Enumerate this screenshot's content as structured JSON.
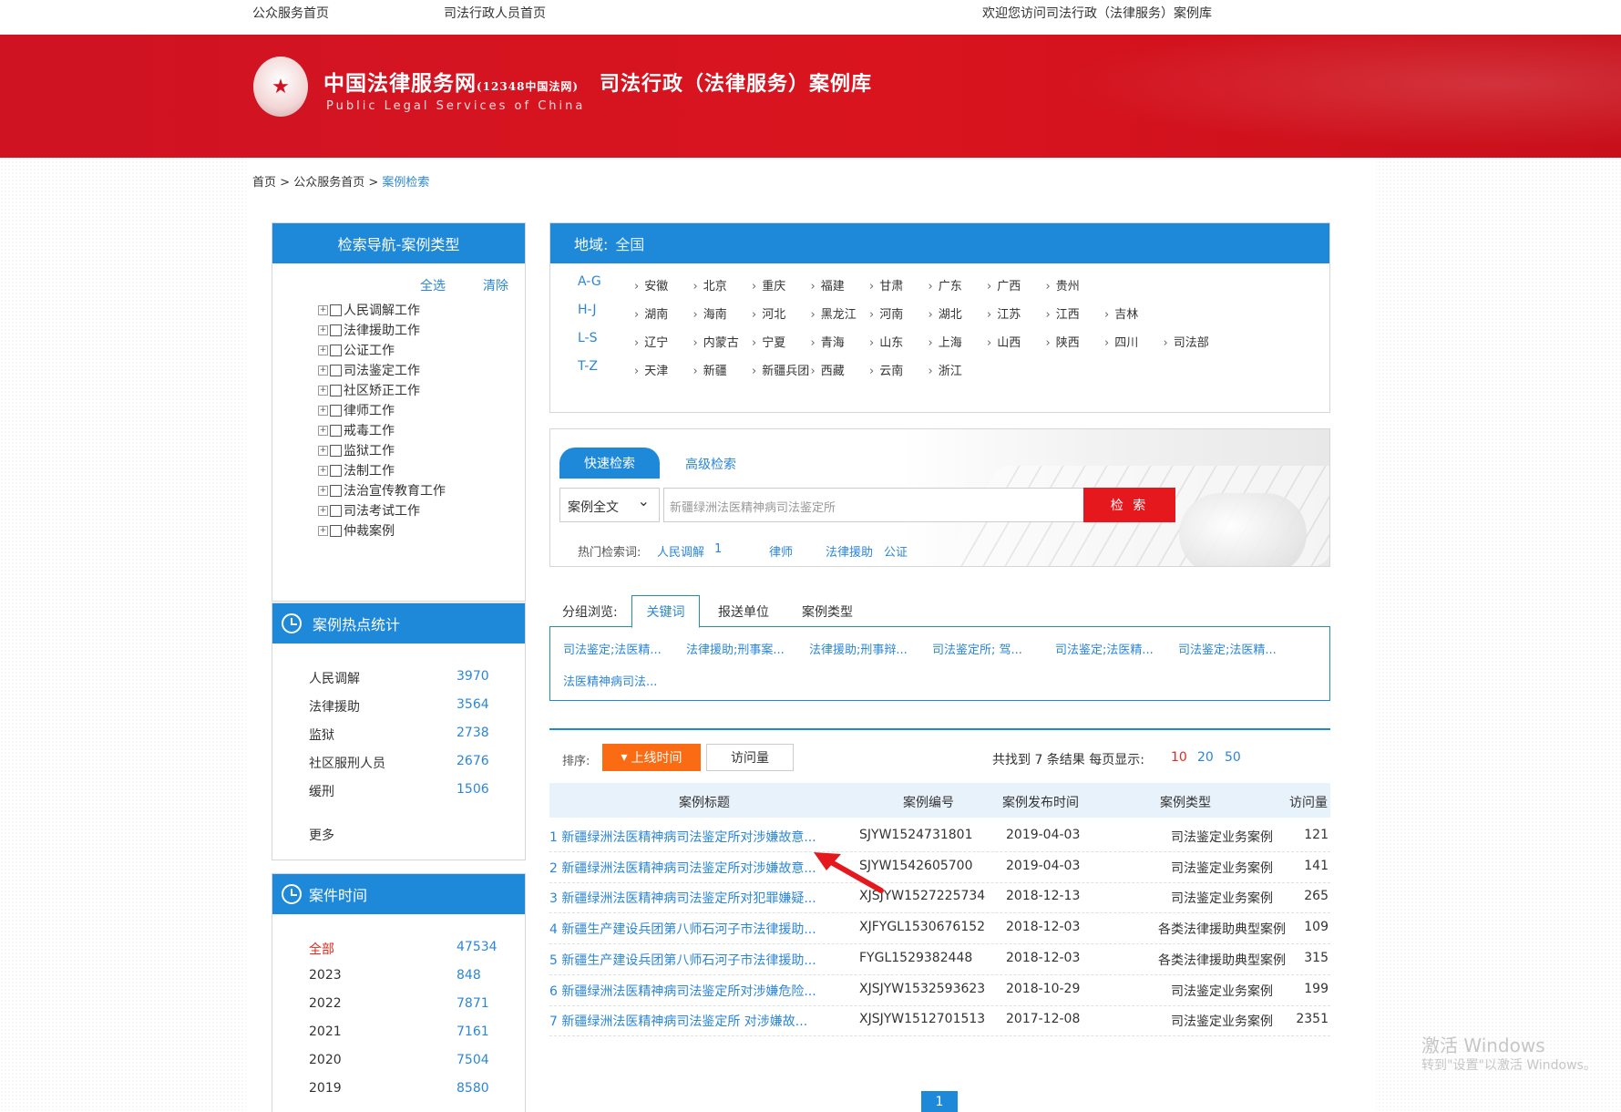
{
  "topbar": {
    "public_home": "公众服务首页",
    "staff_home": "司法行政人员首页",
    "welcome": "欢迎您访问司法行政（法律服务）案例库"
  },
  "header": {
    "logo_cn": "中国法律服务网",
    "logo_cn_small": "(12348中国法网)",
    "logo_en": "Public Legal Services of China",
    "library_title": "司法行政（法律服务）案例库"
  },
  "breadcrumb": {
    "home": "首页",
    "sep": ">",
    "public_home": "公众服务首页",
    "current": "案例检索"
  },
  "nav_panel": {
    "title": "检索导航-案例类型",
    "select_all": "全选",
    "clear": "清除",
    "items": [
      "人民调解工作",
      "法律援助工作",
      "公证工作",
      "司法鉴定工作",
      "社区矫正工作",
      "律师工作",
      "戒毒工作",
      "监狱工作",
      "法制工作",
      "法治宣传教育工作",
      "司法考试工作",
      "仲裁案例"
    ]
  },
  "hot_stats": {
    "title": "案例热点统计",
    "rows": [
      {
        "label": "人民调解",
        "count": "3970"
      },
      {
        "label": "法律援助",
        "count": "3564"
      },
      {
        "label": "监狱",
        "count": "2738"
      },
      {
        "label": "社区服刑人员",
        "count": "2676"
      },
      {
        "label": "缓刑",
        "count": "1506"
      }
    ],
    "more": "更多"
  },
  "case_time": {
    "title": "案件时间",
    "rows": [
      {
        "label": "全部",
        "count": "47534"
      },
      {
        "label": "2023",
        "count": "848"
      },
      {
        "label": "2022",
        "count": "7871"
      },
      {
        "label": "2021",
        "count": "7161"
      },
      {
        "label": "2020",
        "count": "7504"
      },
      {
        "label": "2019",
        "count": "8580"
      }
    ]
  },
  "region": {
    "label": "地域:",
    "all": "全国",
    "groups": [
      {
        "name": "A-G",
        "provinces": [
          "安徽",
          "北京",
          "重庆",
          "福建",
          "甘肃",
          "广东",
          "广西",
          "贵州"
        ]
      },
      {
        "name": "H-J",
        "provinces": [
          "湖南",
          "海南",
          "河北",
          "黑龙江",
          "河南",
          "湖北",
          "江苏",
          "江西",
          "吉林"
        ]
      },
      {
        "name": "L-S",
        "provinces": [
          "辽宁",
          "内蒙古",
          "宁夏",
          "青海",
          "山东",
          "上海",
          "山西",
          "陕西",
          "四川",
          "司法部"
        ]
      },
      {
        "name": "T-Z",
        "provinces": [
          "天津",
          "新疆",
          "新疆兵团",
          "西藏",
          "云南",
          "浙江"
        ]
      }
    ]
  },
  "search": {
    "tab_quick": "快速检索",
    "tab_advanced": "高级检索",
    "scope": "案例全文",
    "query": "新疆绿洲法医精神病司法鉴定所",
    "button": "检 索",
    "hot_label": "热门检索词:",
    "hot_terms": [
      "人民调解",
      "1",
      "律师",
      "法律援助",
      "公证"
    ]
  },
  "group_browse": {
    "label": "分组浏览:",
    "tabs": [
      "关键词",
      "报送单位",
      "案例类型"
    ],
    "keywords": [
      "司法鉴定;法医精...",
      "法律援助;刑事案...",
      "法律援助;刑事辩...",
      "司法鉴定所; 驾...",
      "司法鉴定;法医精...",
      "司法鉴定;法医精...",
      "法医精神病司法..."
    ]
  },
  "results": {
    "sort_label": "排序:",
    "sort_time": "上线时间",
    "sort_visits": "访问量",
    "found_text": "共找到 7 条结果   每页显示:",
    "per_page": [
      "10",
      "20",
      "50"
    ],
    "headers": [
      "案例标题",
      "案例编号",
      "案例发布时间",
      "案例类型",
      "访问量"
    ],
    "rows": [
      {
        "title": "1 新疆绿洲法医精神病司法鉴定所对涉嫌故意...",
        "no": "SJYW1524731801",
        "date": "2019-04-03",
        "type": "司法鉴定业务案例",
        "visits": "121"
      },
      {
        "title": "2 新疆绿洲法医精神病司法鉴定所对涉嫌故意...",
        "no": "SJYW1542605700",
        "date": "2019-04-03",
        "type": "司法鉴定业务案例",
        "visits": "141"
      },
      {
        "title": "3 新疆绿洲法医精神病司法鉴定所对犯罪嫌疑...",
        "no": "XJSJYW1527225734",
        "date": "2018-12-13",
        "type": "司法鉴定业务案例",
        "visits": "265"
      },
      {
        "title": "4 新疆生产建设兵团第八师石河子市法律援助...",
        "no": "XJFYGL1530676152",
        "date": "2018-12-03",
        "type": "各类法律援助典型案例",
        "visits": "109"
      },
      {
        "title": "5 新疆生产建设兵团第八师石河子市法律援助...",
        "no": "FYGL1529382448",
        "date": "2018-12-03",
        "type": "各类法律援助典型案例",
        "visits": "315"
      },
      {
        "title": "6 新疆绿洲法医精神病司法鉴定所对涉嫌危险...",
        "no": "XJSJYW1532593623",
        "date": "2018-10-29",
        "type": "司法鉴定业务案例",
        "visits": "199"
      },
      {
        "title": "7 新疆绿洲法医精神病司法鉴定所 对涉嫌故...",
        "no": "XJSJYW1512701513",
        "date": "2017-12-08",
        "type": "司法鉴定业务案例",
        "visits": "2351"
      }
    ],
    "page": "1"
  },
  "watermark": {
    "line1": "激活 Windows",
    "line2": "转到\"设置\"以激活 Windows。"
  },
  "colors": {
    "brand_red": "#d9141f",
    "accent_blue": "#1e88d9",
    "sort_orange": "#fb6b13",
    "search_red": "#e5181e"
  }
}
